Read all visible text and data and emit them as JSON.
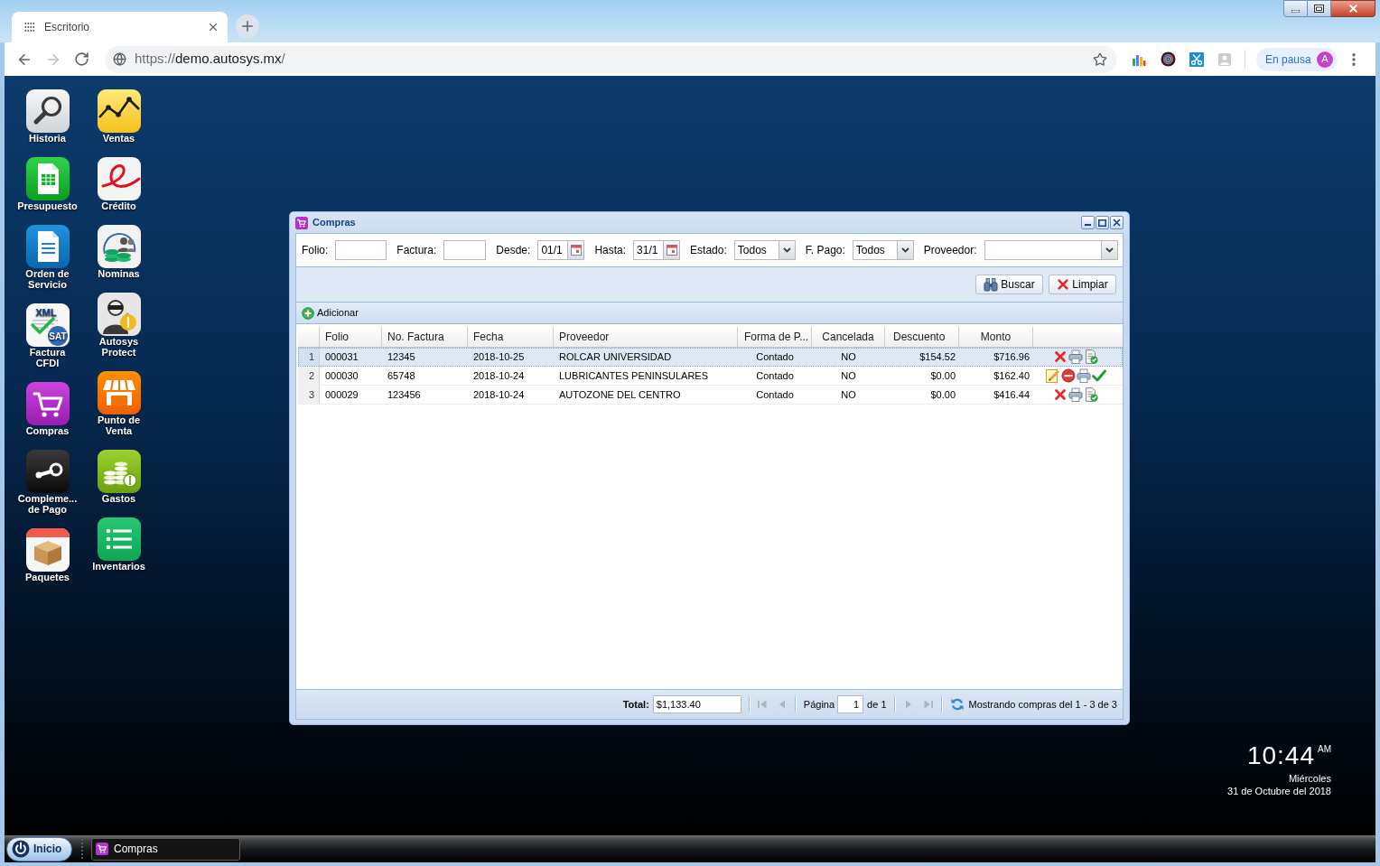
{
  "browser": {
    "tab": {
      "title": "Escritorio"
    },
    "url": {
      "scheme": "https://",
      "host": "demo.autosys.mx",
      "path": "/"
    },
    "profile": {
      "status": "En pausa",
      "initial": "A"
    }
  },
  "desktop": {
    "columns": [
      [
        {
          "kind": "search",
          "lines": [
            "Historia"
          ]
        },
        {
          "kind": "spreadsheet",
          "lines": [
            "Presupuesto"
          ]
        },
        {
          "kind": "document",
          "lines": [
            "Orden de",
            "Servicio"
          ]
        },
        {
          "kind": "xml",
          "lines": [
            "Factura",
            "CFDI"
          ],
          "icon_text": [
            "XML",
            "SAT"
          ]
        },
        {
          "kind": "cart",
          "lines": [
            "Compras"
          ]
        },
        {
          "kind": "linkage",
          "lines": [
            "Compleme...",
            "de Pago"
          ]
        },
        {
          "kind": "box",
          "lines": [
            "Paquetes"
          ]
        }
      ],
      [
        {
          "kind": "chart",
          "lines": [
            "Ventas"
          ]
        },
        {
          "kind": "credit",
          "lines": [
            "Crédito"
          ]
        },
        {
          "kind": "payroll",
          "lines": [
            "Nominas"
          ]
        },
        {
          "kind": "protect",
          "lines": [
            "Autosys",
            "Protect"
          ]
        },
        {
          "kind": "store",
          "lines": [
            "Punto de",
            "Venta"
          ]
        },
        {
          "kind": "coins",
          "lines": [
            "Gastos"
          ]
        },
        {
          "kind": "list",
          "lines": [
            "Inventarios"
          ]
        }
      ]
    ]
  },
  "window": {
    "title": "Compras",
    "filters": [
      {
        "kind": "text",
        "label": "Folio:"
      },
      {
        "kind": "text",
        "label": "Factura:"
      },
      {
        "kind": "date",
        "label": "Desde:",
        "value": "01/1"
      },
      {
        "kind": "date",
        "label": "Hasta:",
        "value": "31/1"
      },
      {
        "kind": "select",
        "label": "Estado:",
        "value": "Todos"
      },
      {
        "kind": "select",
        "label": "F. Pago:",
        "value": "Todos"
      },
      {
        "kind": "select",
        "label": "Proveedor:"
      }
    ],
    "buttons": [
      {
        "kind": "search",
        "label": "Buscar"
      },
      {
        "kind": "clear",
        "label": "Limpiar"
      }
    ],
    "toolbar": {
      "add": "Adicionar"
    },
    "table": {
      "columns": [
        "Folio",
        "No. Factura",
        "Fecha",
        "Proveedor",
        "Forma de P...",
        "Cancelada",
        "Descuento",
        "Monto"
      ],
      "rows": [
        {
          "number": "1",
          "selected": true,
          "cells": [
            "000031",
            "12345",
            "2018-10-25",
            "ROLCAR UNIVERSIDAD",
            "Contado",
            "NO",
            "$154.52",
            "$716.96"
          ],
          "actions": [
            {
              "kind": "cancel"
            },
            {
              "kind": "print"
            },
            {
              "kind": "invoice"
            }
          ]
        },
        {
          "number": "2",
          "selected": false,
          "cells": [
            "000030",
            "65748",
            "2018-10-24",
            "LUBRICANTES PENINSULARES",
            "Contado",
            "NO",
            "$0.00",
            "$162.40"
          ],
          "actions": [
            {
              "kind": "edit"
            },
            {
              "kind": "remove"
            },
            {
              "kind": "print"
            },
            {
              "kind": "approve"
            }
          ]
        },
        {
          "number": "3",
          "selected": false,
          "cells": [
            "000029",
            "123456",
            "2018-10-24",
            "AUTOZONE DEL CENTRO",
            "Contado",
            "NO",
            "$0.00",
            "$416.44"
          ],
          "actions": [
            {
              "kind": "cancel"
            },
            {
              "kind": "print"
            },
            {
              "kind": "invoice"
            }
          ]
        }
      ]
    },
    "paging": {
      "total_label": "Total:",
      "total": "$1,133.40",
      "page_label": "Página",
      "page": "1",
      "page_count": "de 1",
      "status": "Mostrando compras del 1 - 3 de 3"
    }
  },
  "clock": {
    "time": "10:44",
    "meridiem": "AM",
    "weekday": "Miércoles",
    "date": "31 de Octubre del 2018"
  },
  "taskbar": {
    "start": "Inicio",
    "items": [
      {
        "label": "Compras"
      }
    ]
  }
}
